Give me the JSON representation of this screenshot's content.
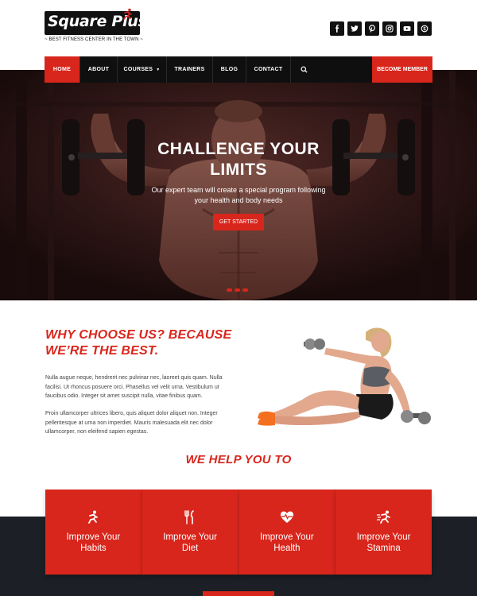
{
  "brand": {
    "name": "Square Plus",
    "tagline": "~ BEST FITNESS CENTER IN THE TOWN ~"
  },
  "social": [
    "facebook-icon",
    "twitter-icon",
    "pinterest-icon",
    "instagram-icon",
    "youtube-icon",
    "skype-icon"
  ],
  "nav": {
    "items": [
      {
        "label": "HOME",
        "active": true
      },
      {
        "label": "ABOUT"
      },
      {
        "label": "COURSES"
      },
      {
        "label": "TRAINERS"
      },
      {
        "label": "BLOG"
      },
      {
        "label": "CONTACT"
      }
    ],
    "member_label": "BECOME MEMBER"
  },
  "hero": {
    "title_line1": "CHALLENGE YOUR",
    "title_line2": "LIMITS",
    "subtitle_line1": "Our expert team will create a special program following",
    "subtitle_line2": "your health and body needs",
    "button": "GET STARTED"
  },
  "why": {
    "title_line1": "WHY CHOOSE US? BECAUSE",
    "title_line2": "WE’RE THE BEST.",
    "para1": "Nulla augue neque, hendrerit nec pulvinar nec, laoreet quis quam. Nulla facilisi. Ut rhoncus posuere orci. Phasellus vel velit urna. Vestibulum ut faucibus odio. Integer sit amet suscipit nulla, vitae finibus quam.",
    "para2": "Proin ullamcorper ultrices libero, quis aliquet dolor aliquet non. Integer pellentesque at urna non imperdiet. Mauris malesuada elit nec dolor ullamcorper, non eleifend sapien egestas."
  },
  "help": {
    "title": "WE HELP YOU TO",
    "cards": [
      {
        "line1": "Improve Your",
        "line2": "Habits",
        "icon": "running-icon"
      },
      {
        "line1": "Improve Your",
        "line2": "Diet",
        "icon": "fork-knife-icon"
      },
      {
        "line1": "Improve Your",
        "line2": "Health",
        "icon": "heartbeat-icon"
      },
      {
        "line1": "Improve Your",
        "line2": "Stamina",
        "icon": "sprint-icon"
      }
    ]
  },
  "colors": {
    "accent": "#d9261c",
    "dark": "#111111",
    "band": "#1d1f26"
  }
}
